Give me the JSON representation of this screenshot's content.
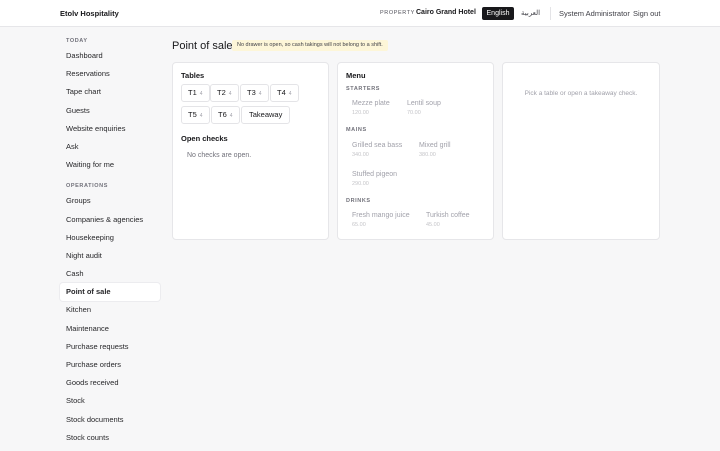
{
  "header": {
    "brand": "Etolv Hospitality",
    "property_label": "PROPERTY",
    "property_name": "Cairo Grand Hotel",
    "lang_en": "English",
    "lang_ar": "العربية",
    "user": "System Administrator",
    "signout": "Sign out"
  },
  "sidebar": {
    "today_label": "TODAY",
    "today": [
      "Dashboard",
      "Reservations",
      "Tape chart",
      "Guests",
      "Website enquiries",
      "Ask",
      "Waiting for me"
    ],
    "operations_label": "OPERATIONS",
    "operations": [
      "Groups",
      "Companies & agencies",
      "Housekeeping",
      "Night audit",
      "Cash",
      "Point of sale",
      "Kitchen",
      "Maintenance",
      "Purchase requests",
      "Purchase orders",
      "Goods received",
      "Stock",
      "Stock documents",
      "Stock counts"
    ],
    "active": "Point of sale"
  },
  "page": {
    "title": "Point of sale",
    "notice": "No drawer is open, so cash takings will not belong to a shift."
  },
  "tables": {
    "title": "Tables",
    "items": [
      {
        "name": "T1",
        "cap": "4"
      },
      {
        "name": "T2",
        "cap": "4"
      },
      {
        "name": "T3",
        "cap": "4"
      },
      {
        "name": "T4",
        "cap": "4"
      },
      {
        "name": "T5",
        "cap": "4"
      },
      {
        "name": "T6",
        "cap": "4"
      }
    ],
    "takeaway": "Takeaway",
    "open_checks_title": "Open checks",
    "open_checks_empty": "No checks are open."
  },
  "menu": {
    "title": "Menu",
    "sections": [
      {
        "label": "STARTERS",
        "items": [
          {
            "name": "Mezze plate",
            "price": "120.00"
          },
          {
            "name": "Lentil soup",
            "price": "70.00"
          }
        ]
      },
      {
        "label": "MAINS",
        "items": [
          {
            "name": "Grilled sea bass",
            "price": "340.00"
          },
          {
            "name": "Mixed grill",
            "price": "380.00"
          },
          {
            "name": "Stuffed pigeon",
            "price": "290.00"
          }
        ]
      },
      {
        "label": "DRINKS",
        "items": [
          {
            "name": "Fresh mango juice",
            "price": "65.00"
          },
          {
            "name": "Turkish coffee",
            "price": "45.00"
          }
        ]
      }
    ]
  },
  "detail": {
    "placeholder": "Pick a table or open a takeaway check."
  },
  "colors": {
    "accent": "#18181b",
    "notice_bg": "#fdf6d8",
    "page_bg": "#f7f7f8"
  }
}
